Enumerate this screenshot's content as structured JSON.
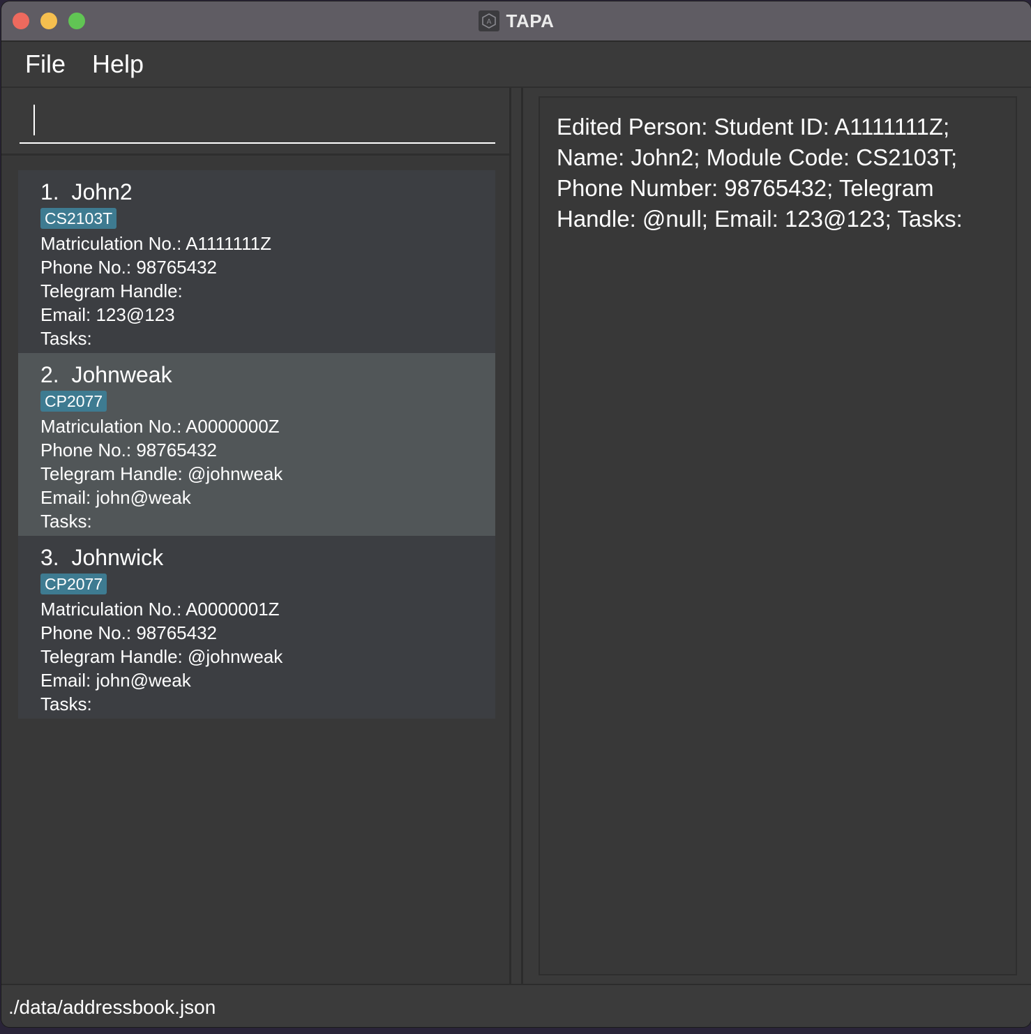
{
  "window": {
    "title": "TAPA",
    "app_icon": "hexagon-a-icon"
  },
  "menubar": {
    "file": "File",
    "help": "Help"
  },
  "command": {
    "value": "",
    "placeholder": ""
  },
  "persons": [
    {
      "index": "1.",
      "name": "John2",
      "tag": "CS2103T",
      "matric": "Matriculation No.: A1111111Z",
      "phone": "Phone No.: 98765432",
      "telegram": "Telegram Handle:",
      "email": "Email: 123@123",
      "tasks": "Tasks:"
    },
    {
      "index": "2.",
      "name": "Johnweak",
      "tag": "CP2077",
      "matric": "Matriculation No.: A0000000Z",
      "phone": "Phone No.: 98765432",
      "telegram": "Telegram Handle: @johnweak",
      "email": "Email: john@weak",
      "tasks": "Tasks:"
    },
    {
      "index": "3.",
      "name": "Johnwick",
      "tag": "CP2077",
      "matric": "Matriculation No.: A0000001Z",
      "phone": "Phone No.: 98765432",
      "telegram": "Telegram Handle: @johnweak",
      "email": "Email: john@weak",
      "tasks": "Tasks:"
    }
  ],
  "result": {
    "text": "Edited Person: Student ID: A1111111Z; Name: John2; Module Code: CS2103T; Phone Number: 98765432; Telegram Handle: @null; Email: 123@123; Tasks:"
  },
  "status": {
    "path": "./data/addressbook.json"
  },
  "colors": {
    "tag": "#3e7b91",
    "selected_card": "#515658",
    "card": "#3c3e42"
  }
}
